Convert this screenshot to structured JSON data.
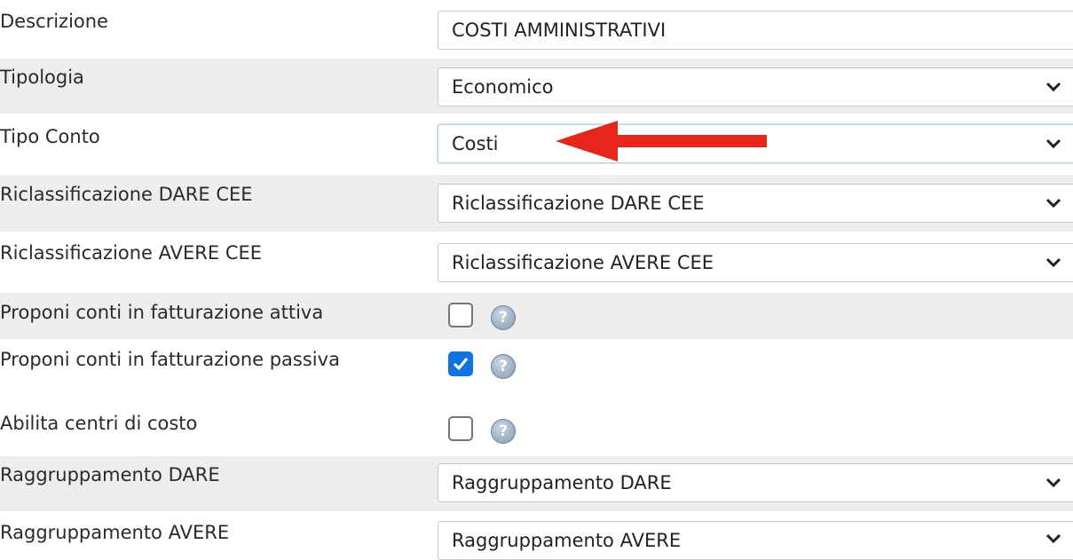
{
  "rows": [
    {
      "label": "Descrizione",
      "value": "COSTI AMMINISTRATIVI"
    },
    {
      "label": "Tipologia",
      "value": "Economico"
    },
    {
      "label": "Tipo Conto",
      "value": "Costi"
    },
    {
      "label": "Riclassificazione DARE CEE",
      "value": "Riclassificazione DARE CEE"
    },
    {
      "label": "Riclassificazione AVERE CEE",
      "value": "Riclassificazione AVERE CEE"
    },
    {
      "label": "Proponi conti in fatturazione attiva",
      "checked": false
    },
    {
      "label": "Proponi conti in fatturazione passiva",
      "checked": true
    },
    {
      "label": "Abilita centri di costo",
      "checked": false
    },
    {
      "label": "Raggruppamento DARE",
      "value": "Raggruppamento DARE"
    },
    {
      "label": "Raggruppamento AVERE",
      "value": "Raggruppamento AVERE"
    }
  ],
  "help_glyph": "?",
  "icons": {
    "dropdown": "chevron-down-icon",
    "help": "help-icon",
    "annotation": "red-arrow-annotation"
  },
  "colors": {
    "arrow": "#e8251b",
    "checkbox_checked": "#0a75e3",
    "row_shade": "#eeeeee"
  }
}
